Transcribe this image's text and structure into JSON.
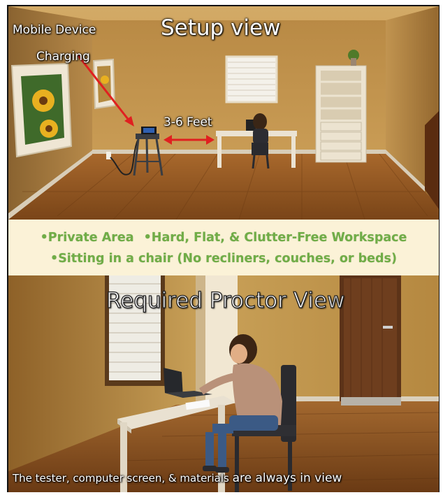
{
  "setup": {
    "title": "Setup view",
    "label_line1": "Mobile Device",
    "label_line2": "Charging",
    "distance": "3-6 Feet"
  },
  "requirements": {
    "item1": "Private Area",
    "item2": "Hard, Flat, & Clutter-Free Workspace",
    "item3": "Sitting in a chair (No recliners, couches, or beds)",
    "bullet": "•"
  },
  "proctor": {
    "title": "Required Proctor View",
    "caption_part1": "The tester, computer screen, & materials",
    "caption_part2": "are always in view"
  },
  "colors": {
    "accent_green": "#70ad47",
    "band_bg": "#fbf2d7",
    "arrow_red": "#e02020"
  }
}
